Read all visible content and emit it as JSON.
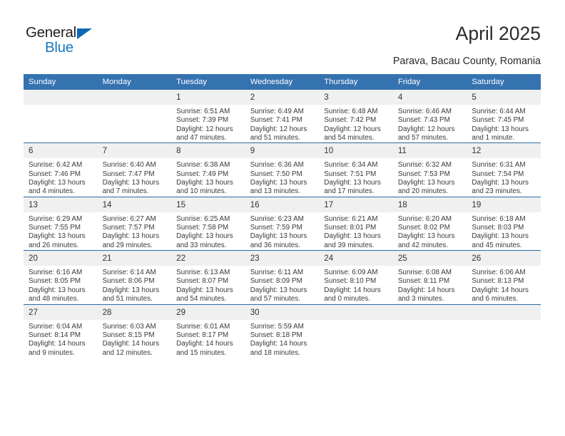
{
  "brand": {
    "name_dark": "General",
    "name_light": "Blue",
    "triangle_color": "#0a6ab8",
    "text_color": "#1878be"
  },
  "header": {
    "title": "April 2025",
    "subtitle": "Parava, Bacau County, Romania"
  },
  "theme": {
    "header_blue": "#3572b0",
    "row_divider_blue": "#2b6ca3",
    "daynum_band": "#f0f0f0",
    "text": "#333333"
  },
  "labels": {
    "sunrise_prefix": "Sunrise:",
    "sunset_prefix": "Sunset:",
    "daylight_prefix": "Daylight:"
  },
  "columns": [
    "Sunday",
    "Monday",
    "Tuesday",
    "Wednesday",
    "Thursday",
    "Friday",
    "Saturday"
  ],
  "weeks": [
    [
      {
        "day": "",
        "empty": true
      },
      {
        "day": "",
        "empty": true
      },
      {
        "day": "1",
        "sunrise": "Sunrise: 6:51 AM",
        "sunset": "Sunset: 7:39 PM",
        "daylight": "Daylight: 12 hours and 47 minutes."
      },
      {
        "day": "2",
        "sunrise": "Sunrise: 6:49 AM",
        "sunset": "Sunset: 7:41 PM",
        "daylight": "Daylight: 12 hours and 51 minutes."
      },
      {
        "day": "3",
        "sunrise": "Sunrise: 6:48 AM",
        "sunset": "Sunset: 7:42 PM",
        "daylight": "Daylight: 12 hours and 54 minutes."
      },
      {
        "day": "4",
        "sunrise": "Sunrise: 6:46 AM",
        "sunset": "Sunset: 7:43 PM",
        "daylight": "Daylight: 12 hours and 57 minutes."
      },
      {
        "day": "5",
        "sunrise": "Sunrise: 6:44 AM",
        "sunset": "Sunset: 7:45 PM",
        "daylight": "Daylight: 13 hours and 1 minute."
      }
    ],
    [
      {
        "day": "6",
        "sunrise": "Sunrise: 6:42 AM",
        "sunset": "Sunset: 7:46 PM",
        "daylight": "Daylight: 13 hours and 4 minutes."
      },
      {
        "day": "7",
        "sunrise": "Sunrise: 6:40 AM",
        "sunset": "Sunset: 7:47 PM",
        "daylight": "Daylight: 13 hours and 7 minutes."
      },
      {
        "day": "8",
        "sunrise": "Sunrise: 6:38 AM",
        "sunset": "Sunset: 7:49 PM",
        "daylight": "Daylight: 13 hours and 10 minutes."
      },
      {
        "day": "9",
        "sunrise": "Sunrise: 6:36 AM",
        "sunset": "Sunset: 7:50 PM",
        "daylight": "Daylight: 13 hours and 13 minutes."
      },
      {
        "day": "10",
        "sunrise": "Sunrise: 6:34 AM",
        "sunset": "Sunset: 7:51 PM",
        "daylight": "Daylight: 13 hours and 17 minutes."
      },
      {
        "day": "11",
        "sunrise": "Sunrise: 6:32 AM",
        "sunset": "Sunset: 7:53 PM",
        "daylight": "Daylight: 13 hours and 20 minutes."
      },
      {
        "day": "12",
        "sunrise": "Sunrise: 6:31 AM",
        "sunset": "Sunset: 7:54 PM",
        "daylight": "Daylight: 13 hours and 23 minutes."
      }
    ],
    [
      {
        "day": "13",
        "sunrise": "Sunrise: 6:29 AM",
        "sunset": "Sunset: 7:55 PM",
        "daylight": "Daylight: 13 hours and 26 minutes."
      },
      {
        "day": "14",
        "sunrise": "Sunrise: 6:27 AM",
        "sunset": "Sunset: 7:57 PM",
        "daylight": "Daylight: 13 hours and 29 minutes."
      },
      {
        "day": "15",
        "sunrise": "Sunrise: 6:25 AM",
        "sunset": "Sunset: 7:58 PM",
        "daylight": "Daylight: 13 hours and 33 minutes."
      },
      {
        "day": "16",
        "sunrise": "Sunrise: 6:23 AM",
        "sunset": "Sunset: 7:59 PM",
        "daylight": "Daylight: 13 hours and 36 minutes."
      },
      {
        "day": "17",
        "sunrise": "Sunrise: 6:21 AM",
        "sunset": "Sunset: 8:01 PM",
        "daylight": "Daylight: 13 hours and 39 minutes."
      },
      {
        "day": "18",
        "sunrise": "Sunrise: 6:20 AM",
        "sunset": "Sunset: 8:02 PM",
        "daylight": "Daylight: 13 hours and 42 minutes."
      },
      {
        "day": "19",
        "sunrise": "Sunrise: 6:18 AM",
        "sunset": "Sunset: 8:03 PM",
        "daylight": "Daylight: 13 hours and 45 minutes."
      }
    ],
    [
      {
        "day": "20",
        "sunrise": "Sunrise: 6:16 AM",
        "sunset": "Sunset: 8:05 PM",
        "daylight": "Daylight: 13 hours and 48 minutes."
      },
      {
        "day": "21",
        "sunrise": "Sunrise: 6:14 AM",
        "sunset": "Sunset: 8:06 PM",
        "daylight": "Daylight: 13 hours and 51 minutes."
      },
      {
        "day": "22",
        "sunrise": "Sunrise: 6:13 AM",
        "sunset": "Sunset: 8:07 PM",
        "daylight": "Daylight: 13 hours and 54 minutes."
      },
      {
        "day": "23",
        "sunrise": "Sunrise: 6:11 AM",
        "sunset": "Sunset: 8:09 PM",
        "daylight": "Daylight: 13 hours and 57 minutes."
      },
      {
        "day": "24",
        "sunrise": "Sunrise: 6:09 AM",
        "sunset": "Sunset: 8:10 PM",
        "daylight": "Daylight: 14 hours and 0 minutes."
      },
      {
        "day": "25",
        "sunrise": "Sunrise: 6:08 AM",
        "sunset": "Sunset: 8:11 PM",
        "daylight": "Daylight: 14 hours and 3 minutes."
      },
      {
        "day": "26",
        "sunrise": "Sunrise: 6:06 AM",
        "sunset": "Sunset: 8:13 PM",
        "daylight": "Daylight: 14 hours and 6 minutes."
      }
    ],
    [
      {
        "day": "27",
        "sunrise": "Sunrise: 6:04 AM",
        "sunset": "Sunset: 8:14 PM",
        "daylight": "Daylight: 14 hours and 9 minutes."
      },
      {
        "day": "28",
        "sunrise": "Sunrise: 6:03 AM",
        "sunset": "Sunset: 8:15 PM",
        "daylight": "Daylight: 14 hours and 12 minutes."
      },
      {
        "day": "29",
        "sunrise": "Sunrise: 6:01 AM",
        "sunset": "Sunset: 8:17 PM",
        "daylight": "Daylight: 14 hours and 15 minutes."
      },
      {
        "day": "30",
        "sunrise": "Sunrise: 5:59 AM",
        "sunset": "Sunset: 8:18 PM",
        "daylight": "Daylight: 14 hours and 18 minutes."
      },
      {
        "day": "",
        "empty": true
      },
      {
        "day": "",
        "empty": true
      },
      {
        "day": "",
        "empty": true
      }
    ]
  ]
}
